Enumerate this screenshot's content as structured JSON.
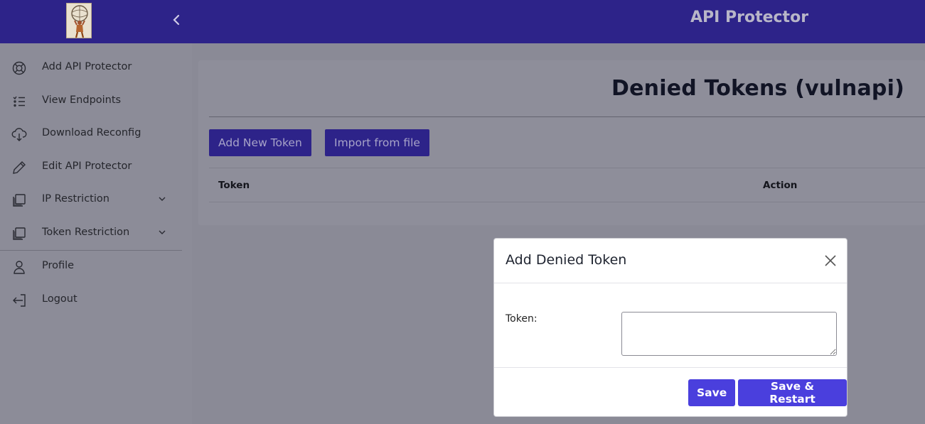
{
  "header": {
    "app_title": "API Protector",
    "logo_icon": "atlas-logo-icon",
    "collapse_icon": "chevron-left-icon",
    "bar_color": "#2d2389"
  },
  "sidebar": {
    "items": [
      {
        "label": "Add API Protector",
        "icon": "lifebuoy-icon"
      },
      {
        "label": "View Endpoints",
        "icon": "list-icon"
      },
      {
        "label": "Download Reconfig",
        "icon": "cloud-download-icon"
      },
      {
        "label": "Edit API Protector",
        "icon": "pencil-icon"
      },
      {
        "label": "IP Restriction",
        "icon": "copy-icon",
        "expandable": true
      },
      {
        "label": "Token Restriction",
        "icon": "copy-icon",
        "expandable": true
      },
      {
        "label": "Profile",
        "icon": "user-icon"
      },
      {
        "label": "Logout",
        "icon": "logout-icon"
      }
    ]
  },
  "main": {
    "page_title": "Denied Tokens (vulnapi)",
    "add_button": "Add New Token",
    "import_button": "Import from file",
    "table": {
      "columns": [
        "Token",
        "Action"
      ],
      "rows": []
    }
  },
  "modal": {
    "title": "Add Denied Token",
    "close_icon": "close-icon",
    "token_label": "Token:",
    "token_value": "",
    "save_button": "Save",
    "save_restart_button": "Save & Restart",
    "accent_color": "#4a3fdd"
  }
}
